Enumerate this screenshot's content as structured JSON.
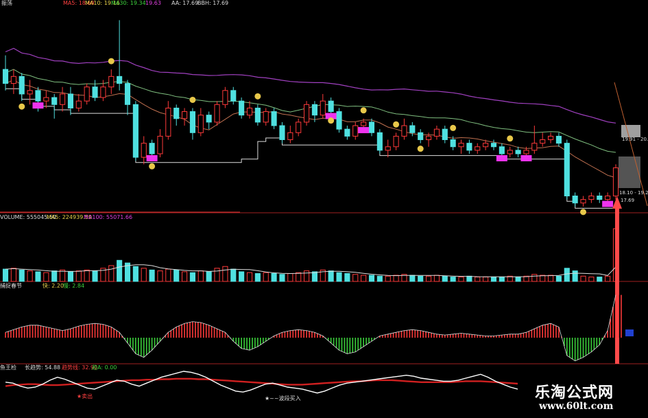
{
  "header": {
    "title": "振荡",
    "ma5": "MA5: 18.69",
    "ma10": "MA10: 19.16",
    "ma30": "MA30: 19.34",
    "extra": "19.63",
    "aa": "AA: 17.69",
    "bbh": "BBH: 17.69"
  },
  "price_labels": {
    "upper": "19.91 - 20.",
    "lower": "18.10 - 19.20",
    "bottom": "17.69"
  },
  "volume_header": {
    "volume": "VOLUME: 555045.50",
    "ma5": "MA5: 224939.59",
    "ma100": "MA100: 55071.66"
  },
  "indicator2_header": {
    "name": "捕捉春节",
    "a": "快: 2.20",
    "b": "慢: 2.84"
  },
  "indicator3_header": {
    "name": "鱼王检",
    "a": "长趋势: 54.88",
    "b": "趋势线: 32.90",
    "c": "趋A: 0.00"
  },
  "annotations": {
    "sell": "★卖出",
    "buy": "★~~波段买入"
  },
  "watermark": {
    "site": "乐淘公式网",
    "url": "www.60lt.com"
  },
  "colors": {
    "up": "#ff3a3a",
    "down": "#4fe0e0",
    "ma_purple": "#a040c0",
    "ma_white": "#dddddd",
    "ma_green": "#80c080",
    "ma_brown": "#c07050",
    "magenta": "#ee33ee",
    "smiley": "#e8c84a"
  },
  "chart_data": {
    "type": "candlestick",
    "candles": [
      [
        20.5,
        20.1,
        20.9,
        19.9
      ],
      [
        20.1,
        20.3,
        20.5,
        19.8
      ],
      [
        20.3,
        19.8,
        20.4,
        19.6
      ],
      [
        19.8,
        19.9,
        20.2,
        19.5
      ],
      [
        19.9,
        19.6,
        20.0,
        19.3
      ],
      [
        19.6,
        19.7,
        19.9,
        19.4
      ],
      [
        19.7,
        19.5,
        19.8,
        19.1
      ],
      [
        19.5,
        19.8,
        20.0,
        19.3
      ],
      [
        19.8,
        19.4,
        20.0,
        19.2
      ],
      [
        19.4,
        19.6,
        19.8,
        19.3
      ],
      [
        19.6,
        20.0,
        20.1,
        19.5
      ],
      [
        20.0,
        19.7,
        20.2,
        19.6
      ],
      [
        19.7,
        20.0,
        20.2,
        19.6
      ],
      [
        20.0,
        20.3,
        20.5,
        19.8
      ],
      [
        20.3,
        20.1,
        21.9,
        19.9
      ],
      [
        20.1,
        19.5,
        20.2,
        19.2
      ],
      [
        19.5,
        18.0,
        19.6,
        17.9
      ],
      [
        18.0,
        18.4,
        18.6,
        17.8
      ],
      [
        18.4,
        18.1,
        18.5,
        17.9
      ],
      [
        18.1,
        18.6,
        18.8,
        18.0
      ],
      [
        18.6,
        19.4,
        19.6,
        18.5
      ],
      [
        19.4,
        19.1,
        19.5,
        18.9
      ],
      [
        19.1,
        19.3,
        19.4,
        18.9
      ],
      [
        19.3,
        18.7,
        19.4,
        18.5
      ],
      [
        18.7,
        19.2,
        19.4,
        18.6
      ],
      [
        19.2,
        19.0,
        19.3,
        18.8
      ],
      [
        19.0,
        19.5,
        19.6,
        18.9
      ],
      [
        19.5,
        19.9,
        20.0,
        19.4
      ],
      [
        19.9,
        19.6,
        20.0,
        19.5
      ],
      [
        19.6,
        19.2,
        19.7,
        19.1
      ],
      [
        19.2,
        19.4,
        19.6,
        19.1
      ],
      [
        19.4,
        19.0,
        19.5,
        18.9
      ],
      [
        19.0,
        19.3,
        19.4,
        18.9
      ],
      [
        19.3,
        18.9,
        19.4,
        18.8
      ],
      [
        18.9,
        18.5,
        19.0,
        18.4
      ],
      [
        18.5,
        18.7,
        18.9,
        18.4
      ],
      [
        18.7,
        19.0,
        19.1,
        18.6
      ],
      [
        19.0,
        19.5,
        19.6,
        18.9
      ],
      [
        19.5,
        19.2,
        19.6,
        19.0
      ],
      [
        19.2,
        19.6,
        19.8,
        19.1
      ],
      [
        19.6,
        19.3,
        19.7,
        19.2
      ],
      [
        19.3,
        18.8,
        19.4,
        18.7
      ],
      [
        18.8,
        18.6,
        18.9,
        18.5
      ],
      [
        18.6,
        18.9,
        19.0,
        18.5
      ],
      [
        18.9,
        19.0,
        19.1,
        18.8
      ],
      [
        19.0,
        18.7,
        19.1,
        18.6
      ],
      [
        18.7,
        18.2,
        18.8,
        18.1
      ],
      [
        18.2,
        18.3,
        18.5,
        18.0
      ],
      [
        18.3,
        18.6,
        18.7,
        18.2
      ],
      [
        18.6,
        18.9,
        19.1,
        18.5
      ],
      [
        18.9,
        18.7,
        19.0,
        18.6
      ],
      [
        18.7,
        18.5,
        18.8,
        18.4
      ],
      [
        18.5,
        18.6,
        18.7,
        18.3
      ],
      [
        18.6,
        18.8,
        18.9,
        18.5
      ],
      [
        18.8,
        18.5,
        18.9,
        18.4
      ],
      [
        18.5,
        18.3,
        18.6,
        18.2
      ],
      [
        18.3,
        18.4,
        18.5,
        18.1
      ],
      [
        18.4,
        18.2,
        18.5,
        18.1
      ],
      [
        18.2,
        18.3,
        18.4,
        18.1
      ],
      [
        18.3,
        18.4,
        18.5,
        18.2
      ],
      [
        18.4,
        18.3,
        18.5,
        18.2
      ],
      [
        18.3,
        18.1,
        18.4,
        18.0
      ],
      [
        18.1,
        18.2,
        18.3,
        18.0
      ],
      [
        18.2,
        18.1,
        18.3,
        18.0
      ],
      [
        18.1,
        18.2,
        18.3,
        18.0
      ],
      [
        18.2,
        18.4,
        18.9,
        18.1
      ],
      [
        18.4,
        18.5,
        18.7,
        18.3
      ],
      [
        18.5,
        18.6,
        18.7,
        18.4
      ],
      [
        18.6,
        18.4,
        18.7,
        18.3
      ],
      [
        18.4,
        16.9,
        18.5,
        16.8
      ],
      [
        16.9,
        16.7,
        17.0,
        16.6
      ],
      [
        16.7,
        16.8,
        16.9,
        16.6
      ],
      [
        16.8,
        16.9,
        17.0,
        16.7
      ],
      [
        16.9,
        16.8,
        17.0,
        16.7
      ],
      [
        16.8,
        16.9,
        17.0,
        16.7
      ],
      [
        16.9,
        17.7,
        17.8,
        16.8
      ]
    ],
    "volume": [
      28,
      30,
      26,
      24,
      22,
      20,
      24,
      26,
      22,
      24,
      26,
      24,
      30,
      36,
      48,
      42,
      34,
      30,
      26,
      24,
      28,
      26,
      22,
      20,
      24,
      22,
      30,
      34,
      28,
      22,
      20,
      18,
      20,
      18,
      16,
      18,
      20,
      24,
      22,
      26,
      24,
      20,
      18,
      16,
      14,
      14,
      12,
      12,
      14,
      16,
      14,
      12,
      12,
      14,
      12,
      10,
      10,
      12,
      10,
      10,
      10,
      10,
      12,
      10,
      12,
      16,
      14,
      14,
      12,
      30,
      24,
      12,
      10,
      10,
      12,
      120
    ],
    "oscillator": [
      6,
      9,
      12,
      14,
      14,
      12,
      10,
      8,
      10,
      13,
      15,
      16,
      15,
      12,
      6,
      -6,
      -18,
      -22,
      -14,
      -4,
      6,
      12,
      16,
      18,
      17,
      14,
      10,
      6,
      -4,
      -12,
      -14,
      -10,
      -4,
      2,
      6,
      8,
      9,
      8,
      6,
      2,
      -6,
      -14,
      -18,
      -16,
      -10,
      -4,
      2,
      4,
      6,
      8,
      9,
      8,
      6,
      4,
      3,
      4,
      5,
      4,
      3,
      2,
      2,
      3,
      4,
      4,
      6,
      10,
      14,
      16,
      12,
      -20,
      -26,
      -22,
      -16,
      -8,
      8,
      48
    ],
    "long_trend": [
      60,
      58,
      52,
      48,
      50,
      56,
      64,
      70,
      66,
      60,
      54,
      48,
      46,
      52,
      58,
      64,
      62,
      56,
      52,
      58,
      64,
      70,
      74,
      78,
      82,
      80,
      76,
      70,
      62,
      54,
      48,
      42,
      40,
      44,
      50,
      56,
      58,
      54,
      50,
      48,
      46,
      42,
      38,
      42,
      48,
      54,
      58,
      60,
      62,
      64,
      66,
      68,
      70,
      72,
      74,
      72,
      68,
      66,
      64,
      62,
      62,
      64,
      68,
      72,
      76,
      70,
      62,
      56,
      50,
      46
    ],
    "trend_line": [
      52,
      54,
      55,
      56,
      56,
      55,
      54,
      54,
      55,
      56,
      57,
      58,
      59,
      60,
      61,
      62,
      63,
      64,
      64,
      65,
      65,
      66,
      66,
      67,
      67,
      67,
      66,
      66,
      65,
      64,
      63,
      62,
      61,
      60,
      59,
      58,
      57,
      56,
      55,
      55,
      55,
      56,
      57,
      58,
      59,
      60,
      61,
      62,
      62,
      63,
      64,
      64,
      64,
      63,
      62,
      61,
      60,
      60,
      60,
      60,
      60,
      61,
      62,
      62,
      62,
      61,
      60,
      59,
      58,
      57
    ]
  }
}
